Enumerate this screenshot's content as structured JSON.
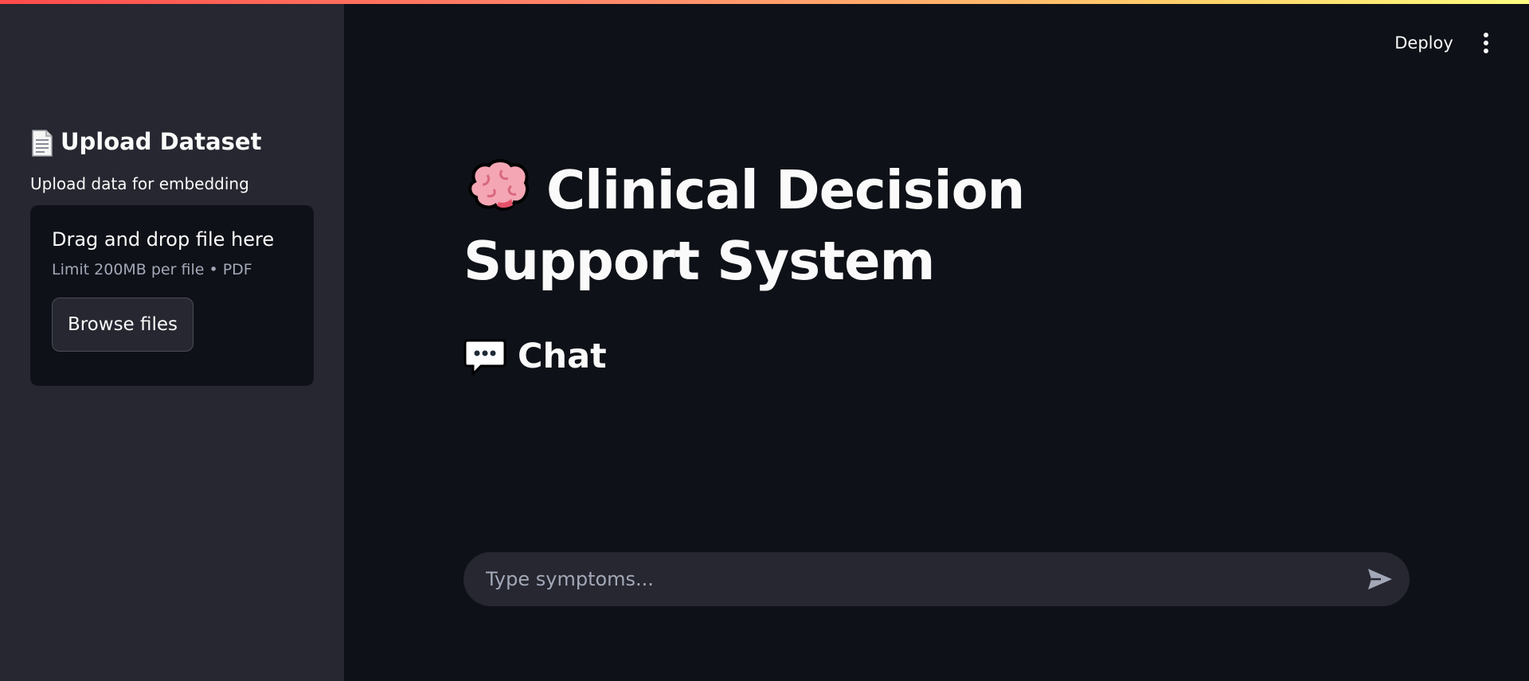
{
  "sidebar": {
    "heading": "Upload Dataset",
    "heading_icon": "page-facing-up-icon",
    "uploader": {
      "label": "Upload data for embedding",
      "dropzone_title": "Drag and drop file here",
      "dropzone_limit": "Limit 200MB per file • PDF",
      "browse_label": "Browse files"
    }
  },
  "header": {
    "deploy_label": "Deploy",
    "menu_icon": "vertical-ellipsis-icon"
  },
  "main": {
    "title": "Clinical Decision Support System",
    "title_icon": "brain-icon",
    "chat_heading": "Chat",
    "chat_icon": "speech-balloon-icon"
  },
  "chat_input": {
    "placeholder": "Type symptoms...",
    "send_icon": "send-icon"
  },
  "colors": {
    "background": "#0e1117",
    "sidebar": "#262730",
    "text": "#fafafa",
    "muted_text": "#a3a8b8",
    "accent": "#ff4b4b"
  }
}
